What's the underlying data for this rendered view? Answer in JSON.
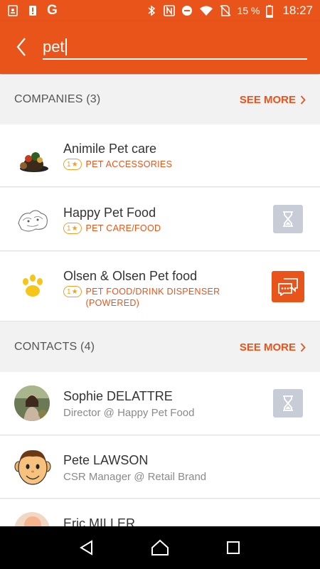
{
  "status_bar": {
    "battery": "15 %",
    "time": "18:27",
    "left_icons": [
      "app-notification-icon",
      "alert-icon",
      "google-icon"
    ],
    "right_icons": [
      "bluetooth-icon",
      "nfc-icon",
      "do-not-disturb-icon",
      "wifi-icon",
      "no-sim-icon",
      "battery-icon"
    ]
  },
  "search": {
    "query": "pet"
  },
  "companies": {
    "title": "COMPANIES (3)",
    "see_more": "SEE MORE",
    "items": [
      {
        "name": "Animile Pet care",
        "rating": "1",
        "category": "PET ACCESSORIES",
        "action": null
      },
      {
        "name": "Happy Pet Food",
        "rating": "1",
        "category": "PET CARE/FOOD",
        "action": "hourglass-icon"
      },
      {
        "name": "Olsen & Olsen Pet food",
        "rating": "1",
        "category_line1": "PET FOOD/DRINK DISPENSER",
        "category_line2": "(POWERED)",
        "action": "chat-icon"
      }
    ]
  },
  "contacts": {
    "title": "CONTACTS (4)",
    "see_more": "SEE MORE",
    "items": [
      {
        "name": "Sophie DELATTRE",
        "subtitle": "Director @ Happy Pet Food",
        "action": "hourglass-icon"
      },
      {
        "name": "Pete LAWSON",
        "subtitle": "CSR Manager @ Retail Brand",
        "action": null
      },
      {
        "name": "Eric MILLER"
      }
    ]
  },
  "colors": {
    "accent": "#e8541a",
    "rating": "#f0a020",
    "action_grey": "#c7ccd6"
  }
}
